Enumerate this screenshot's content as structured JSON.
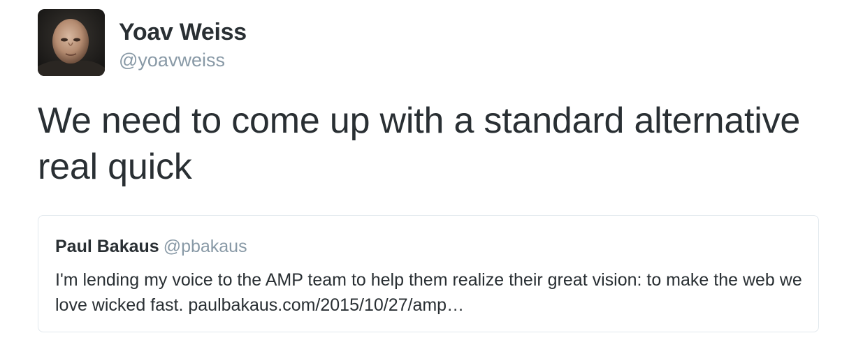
{
  "tweet": {
    "author": {
      "name": "Yoav Weiss",
      "handle": "@yoavweiss"
    },
    "text": "We need to come up with a standard alternative real quick",
    "quoted_tweet": {
      "author_name": "Paul Bakaus",
      "author_handle": "@pbakaus",
      "text": "I'm lending my voice to the AMP team to help them realize their great vision: to make the web we love wicked fast.",
      "link_text": "paulbakaus.com/2015/10/27/amp…"
    }
  },
  "colors": {
    "text": "#292f33",
    "secondary_text": "#8899a6",
    "border": "#e1e8ed"
  }
}
